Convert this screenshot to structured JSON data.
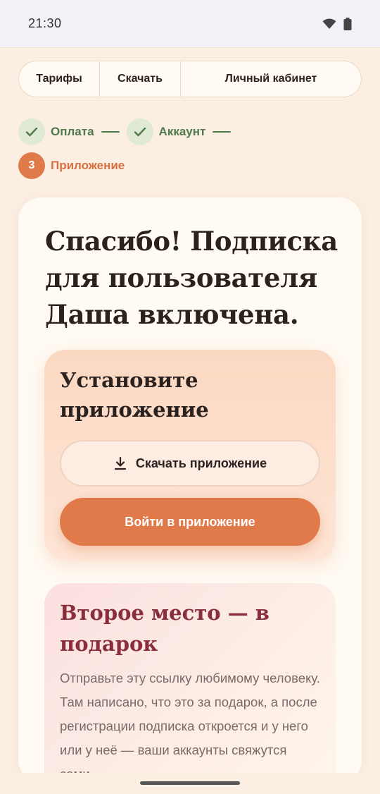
{
  "status_bar": {
    "time": "21:30",
    "icons": [
      "wifi-icon",
      "battery-icon"
    ]
  },
  "nav": {
    "items": [
      {
        "label": "Тарифы"
      },
      {
        "label": "Скачать"
      },
      {
        "label": "Личный кабинет"
      }
    ]
  },
  "steps": [
    {
      "label": "Оплата",
      "state": "done",
      "icon": "check-icon"
    },
    {
      "label": "Аккаунт",
      "state": "done",
      "icon": "check-icon"
    },
    {
      "number": "3",
      "label": "Приложение",
      "state": "active"
    }
  ],
  "card": {
    "title": "Спасибо! Подписка для пользователя Даша включена.",
    "install": {
      "title": "Установите приложение",
      "download_label": "Скачать приложение",
      "download_icon": "download-icon",
      "login_label": "Войти в приложение"
    },
    "gift": {
      "title": "Второе место — в подарок",
      "text": "Отправьте эту ссылку любимому человеку. Там написано, что это за подарок, а после регистрации подписка откроется и у него или у неё — ваши аккаунты свяжутся сами."
    }
  },
  "colors": {
    "accent": "#e07a4b",
    "success": "#4f7a4a",
    "gift_title": "#8a2e3c",
    "background": "#fbeee2"
  }
}
